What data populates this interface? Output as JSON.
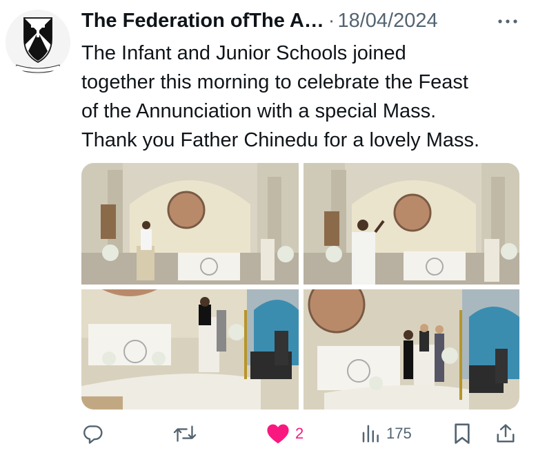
{
  "tweet": {
    "author_name": "The Federation ofThe A…",
    "separator": "·",
    "date": "18/04/2024",
    "avatar_motto": "VERITAS",
    "text_lines": [
      "The Infant and Junior Schools joined",
      "together this morning to celebrate the Feast",
      "of the Annunciation with a special Mass.",
      "Thank you Father Chinedu for a lovely Mass."
    ]
  },
  "media": {
    "photos": [
      {
        "name": "church-altar-photo-1"
      },
      {
        "name": "church-altar-photo-2"
      },
      {
        "name": "church-altar-photo-3"
      },
      {
        "name": "church-altar-photo-4"
      }
    ]
  },
  "actions": {
    "reply": {
      "icon": "reply-icon",
      "count": ""
    },
    "retweet": {
      "icon": "retweet-icon",
      "count": ""
    },
    "like": {
      "icon": "heart-icon",
      "count": "2",
      "color": "#f91880"
    },
    "views": {
      "icon": "views-icon",
      "count": "175"
    },
    "bookmark": {
      "icon": "bookmark-icon"
    },
    "share": {
      "icon": "share-icon"
    }
  },
  "colors": {
    "text": "#0f1419",
    "muted": "#536471",
    "like": "#f91880"
  }
}
